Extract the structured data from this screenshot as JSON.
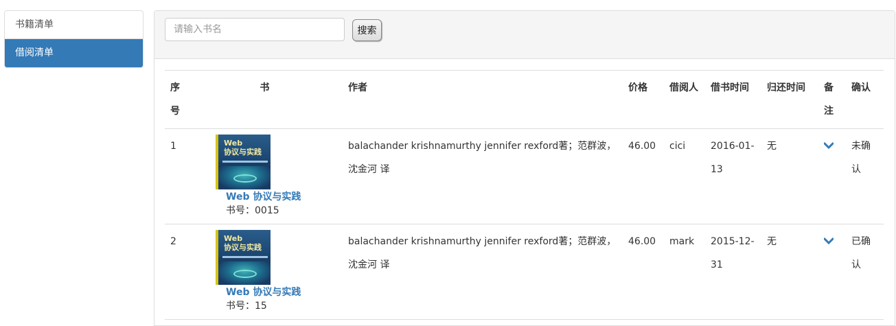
{
  "sidebar": {
    "items": [
      {
        "label": "书籍清单",
        "active": false
      },
      {
        "label": "借阅清单",
        "active": true
      }
    ]
  },
  "search": {
    "placeholder": "请输入书名",
    "value": "",
    "button_label": "搜索"
  },
  "table": {
    "headers": {
      "idx": "序号",
      "book": "书",
      "author": "作者",
      "price": "价格",
      "borrower": "借阅人",
      "borrow_time": "借书时间",
      "return_time": "归还时间",
      "note": "备注",
      "confirm": "确认"
    },
    "rows": [
      {
        "idx": "1",
        "book_title": "Web 协议与实践",
        "book_code": "书号：0015",
        "author": "balachander krishnamurthy jennifer rexford著；范群波，沈金河 译",
        "price": "46.00",
        "borrower": "cici",
        "borrow_time": "2016-01-13",
        "return_time": "无",
        "confirm": "未确认"
      },
      {
        "idx": "2",
        "book_title": "Web 协议与实践",
        "book_code": "书号：15",
        "author": "balachander krishnamurthy jennifer rexford著；范群波，沈金河 译",
        "price": "46.00",
        "borrower": "mark",
        "borrow_time": "2015-12-31",
        "return_time": "无",
        "confirm": "已确认"
      }
    ]
  },
  "icons": {
    "note": "chevron-down-icon",
    "cover": "book-cover-image"
  },
  "colors": {
    "primary": "#337ab7",
    "panel_heading": "#f5f5f5",
    "border": "#dddddd"
  }
}
